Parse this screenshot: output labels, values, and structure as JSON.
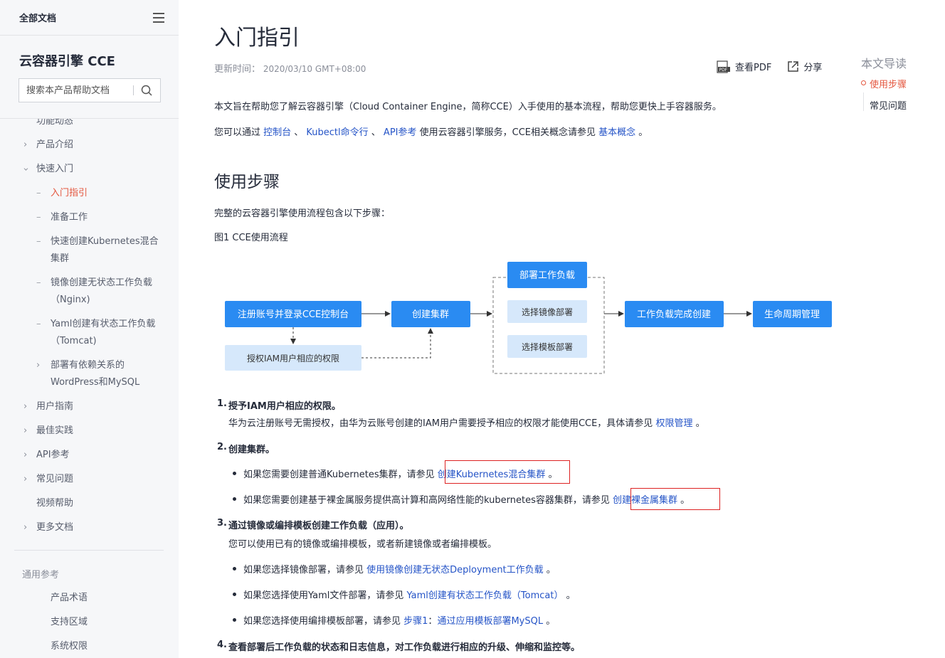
{
  "sidebar": {
    "all_docs": "全部文档",
    "product_title": "云容器引擎 CCE",
    "search_placeholder": "搜索本产品帮助文档",
    "items": [
      {
        "label": "功能动态",
        "type": "top"
      },
      {
        "label": "产品介绍",
        "type": "collapsed"
      },
      {
        "label": "快速入门",
        "type": "expanded"
      },
      {
        "label": "入门指引",
        "type": "sub",
        "active": true
      },
      {
        "label": "准备工作",
        "type": "sub"
      },
      {
        "label": "快速创建Kubernetes混合集群",
        "type": "sub"
      },
      {
        "label": "镜像创建无状态工作负载（Nginx)",
        "type": "sub"
      },
      {
        "label": "Yaml创建有状态工作负载（Tomcat)",
        "type": "sub"
      },
      {
        "label": "部署有依赖关系的WordPress和MySQL",
        "type": "subcollapsed"
      },
      {
        "label": "用户指南",
        "type": "collapsed"
      },
      {
        "label": "最佳实践",
        "type": "collapsed"
      },
      {
        "label": "API参考",
        "type": "collapsed"
      },
      {
        "label": "常见问题",
        "type": "collapsed"
      },
      {
        "label": "视频帮助",
        "type": "leaf"
      },
      {
        "label": "更多文档",
        "type": "collapsed"
      }
    ],
    "reference_heading": "通用参考",
    "reference_items": [
      "产品术语",
      "支持区域",
      "系统权限"
    ]
  },
  "main": {
    "title": "入门指引",
    "updated_label": "更新时间：",
    "updated_value": "2020/03/10 GMT+08:00",
    "view_pdf": "查看PDF",
    "share": "分享",
    "intro": "本文旨在帮助您了解云容器引擎（Cloud Container Engine，简称CCE）入手使用的基本流程，帮助您更快上手容器服务。",
    "intro2": {
      "pre": "您可以通过 ",
      "link1": "控制台",
      "sep1": " 、 ",
      "link2": "Kubectl命令行",
      "sep2": " 、 ",
      "link3": "API参考",
      "mid": " 使用云容器引擎服务，CCE相关概念请参见 ",
      "link4": "基本概念",
      "end": " 。"
    },
    "section_title": "使用步骤",
    "section_desc": "完整的云容器引擎使用流程包含以下步骤：",
    "figure_caption": "图1 CCE使用流程",
    "flow": {
      "register": "注册账号并登录CCE控制台",
      "create_cluster": "创建集群",
      "deploy": "部署工作负载",
      "by_image": "选择镜像部署",
      "by_template": "选择模板部署",
      "done": "工作负载完成创建",
      "lifecycle": "生命周期管理",
      "grant": "授权IAM用户相应的权限"
    },
    "steps": {
      "s1_title": "授予IAM用户相应的权限。",
      "s1_text": "华为云注册账号无需授权，由华为云账号创建的IAM用户需要授予相应的权限才能使用CCE，具体请参见 ",
      "s1_link": "权限管理",
      "s1_end": " 。",
      "s2_title": "创建集群。",
      "s2_b1_text": "如果您需要创建普通Kubernetes集群，请参见 ",
      "s2_b1_link": "创建Kubernetes混合集群",
      "s2_b1_end": " 。",
      "s2_b2_text": "如果您需要创建基于裸金属服务提供高计算和高网络性能的kubernetes容器集群，请参见 ",
      "s2_b2_link": "创建裸金属集群",
      "s2_b2_end": " 。",
      "s3_title": "通过镜像或编排模板创建工作负载（应用）。",
      "s3_text": "您可以使用已有的镜像或编排模板，或者新建镜像或者编排模板。",
      "s3_b1_text": "如果您选择镜像部署，请参见 ",
      "s3_b1_link": "使用镜像创建无状态Deployment工作负载",
      "s3_b1_end": " 。",
      "s3_b2_text": "如果您选择使用Yaml文件部署，请参见 ",
      "s3_b2_link": "Yaml创建有状态工作负载（Tomcat）",
      "s3_b2_end": " 。",
      "s3_b3_text": "如果您选择使用编排模板部署，请参见 ",
      "s3_b3_link1": "步骤1",
      "s3_b3_colon": "：",
      "s3_b3_link2": "通过应用模板部署MySQL",
      "s3_b3_end": " 。",
      "s4_title": "查看部署后工作负载的状态和日志信息，对工作负载进行相应的升级、伸缩和监控等。"
    }
  },
  "toc": {
    "title": "本文导读",
    "items": [
      "使用步骤",
      "常见问题"
    ]
  },
  "colors": {
    "accent": "#e4573f",
    "link": "#2554c7",
    "flow_blue": "#2a8bf2",
    "flow_light": "#d6e8fb",
    "highlight_box": "#dd2222"
  }
}
